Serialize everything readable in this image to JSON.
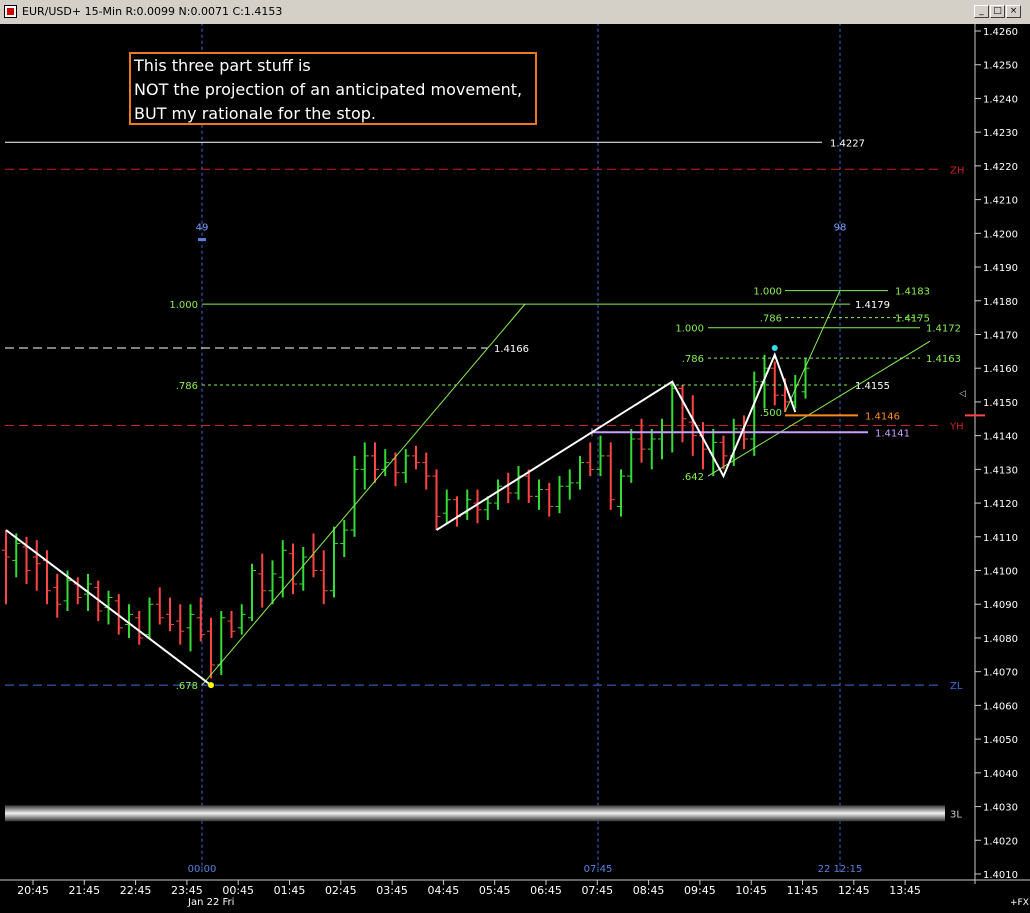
{
  "window": {
    "title": "EUR/USD+ 15-Min R:0.0099 N:0.0071 C:1.4153",
    "buttons": [
      "_",
      "□",
      "×"
    ]
  },
  "annotation": [
    "This three part stuff is",
    "NOT the projection of an anticipated movement,",
    "BUT my rationale for the stop."
  ],
  "colors": {
    "background": "#000000",
    "up_bar": "#33dd33",
    "down_bar": "#ff4444",
    "fib_line": "#88ee55",
    "zone_red": "#d02020",
    "zone_blue": "#3a6edc",
    "pattern": "#ffffff",
    "stop_line": "#ff8c1a",
    "yh_line": "#c8a0ff",
    "note_border": "#e87a20"
  },
  "chart_data": {
    "type": "candlestick",
    "symbol": "EUR/USD+",
    "interval": "15-Min",
    "ylim": [
      1.401,
      1.4266
    ],
    "y_ticks": [
      "1.4260",
      "1.4250",
      "1.4240",
      "1.4230",
      "1.4220",
      "1.4210",
      "1.4200",
      "1.4190",
      "1.4180",
      "1.4170",
      "1.4160",
      "1.4150",
      "1.4140",
      "1.4130",
      "1.4120",
      "1.4110",
      "1.4100",
      "1.4090",
      "1.4080",
      "1.4070",
      "1.4060",
      "1.4050",
      "1.4040",
      "1.4030",
      "1.4020",
      "1.4010"
    ],
    "x_ticks": [
      "20:45",
      "21:45",
      "22:45",
      "23:45",
      "00:45",
      "01:45",
      "02:45",
      "03:45",
      "04:45",
      "05:45",
      "06:45",
      "07:45",
      "08:45",
      "09:45",
      "10:45",
      "11:45",
      "12:45",
      "13:45"
    ],
    "x_sublabel": "Jan 22 Fri",
    "axis_corner": "+FX",
    "bars": [
      {
        "o": 1.4106,
        "h": 1.4112,
        "l": 1.409,
        "c": 1.4104
      },
      {
        "o": 1.4103,
        "h": 1.4111,
        "l": 1.4098,
        "c": 1.4108
      },
      {
        "o": 1.4107,
        "h": 1.411,
        "l": 1.4096,
        "c": 1.41
      },
      {
        "o": 1.4104,
        "h": 1.4109,
        "l": 1.4094,
        "c": 1.4102
      },
      {
        "o": 1.4103,
        "h": 1.4106,
        "l": 1.409,
        "c": 1.4094
      },
      {
        "o": 1.4095,
        "h": 1.4099,
        "l": 1.4086,
        "c": 1.409
      },
      {
        "o": 1.4091,
        "h": 1.41,
        "l": 1.4088,
        "c": 1.4097
      },
      {
        "o": 1.4096,
        "h": 1.4098,
        "l": 1.409,
        "c": 1.4092
      },
      {
        "o": 1.4093,
        "h": 1.4099,
        "l": 1.4088,
        "c": 1.4096
      },
      {
        "o": 1.4095,
        "h": 1.4097,
        "l": 1.4085,
        "c": 1.4088
      },
      {
        "o": 1.4089,
        "h": 1.4094,
        "l": 1.4084,
        "c": 1.4092
      },
      {
        "o": 1.4091,
        "h": 1.4093,
        "l": 1.4081,
        "c": 1.4083
      },
      {
        "o": 1.4084,
        "h": 1.409,
        "l": 1.408,
        "c": 1.4087
      },
      {
        "o": 1.4086,
        "h": 1.4088,
        "l": 1.4078,
        "c": 1.408
      },
      {
        "o": 1.4081,
        "h": 1.4092,
        "l": 1.408,
        "c": 1.409
      },
      {
        "o": 1.409,
        "h": 1.4095,
        "l": 1.4084,
        "c": 1.4086
      },
      {
        "o": 1.4087,
        "h": 1.4092,
        "l": 1.4082,
        "c": 1.4084
      },
      {
        "o": 1.4085,
        "h": 1.409,
        "l": 1.4078,
        "c": 1.4082
      },
      {
        "o": 1.4083,
        "h": 1.409,
        "l": 1.4076,
        "c": 1.4087
      },
      {
        "o": 1.4086,
        "h": 1.4092,
        "l": 1.4079,
        "c": 1.4081
      },
      {
        "o": 1.4082,
        "h": 1.4086,
        "l": 1.4068,
        "c": 1.4072
      },
      {
        "o": 1.4072,
        "h": 1.4088,
        "l": 1.4069,
        "c": 1.4086
      },
      {
        "o": 1.4085,
        "h": 1.4088,
        "l": 1.408,
        "c": 1.4082
      },
      {
        "o": 1.4083,
        "h": 1.409,
        "l": 1.4081,
        "c": 1.4087
      },
      {
        "o": 1.4086,
        "h": 1.4102,
        "l": 1.4085,
        "c": 1.41
      },
      {
        "o": 1.4099,
        "h": 1.4105,
        "l": 1.4089,
        "c": 1.4094
      },
      {
        "o": 1.4094,
        "h": 1.4103,
        "l": 1.409,
        "c": 1.4099
      },
      {
        "o": 1.4098,
        "h": 1.4109,
        "l": 1.4092,
        "c": 1.4106
      },
      {
        "o": 1.4105,
        "h": 1.4108,
        "l": 1.4093,
        "c": 1.4096
      },
      {
        "o": 1.4096,
        "h": 1.4107,
        "l": 1.4094,
        "c": 1.4104
      },
      {
        "o": 1.4104,
        "h": 1.4111,
        "l": 1.4098,
        "c": 1.41
      },
      {
        "o": 1.41,
        "h": 1.4106,
        "l": 1.409,
        "c": 1.4094
      },
      {
        "o": 1.4094,
        "h": 1.4113,
        "l": 1.4092,
        "c": 1.4108
      },
      {
        "o": 1.4108,
        "h": 1.4115,
        "l": 1.4104,
        "c": 1.4112
      },
      {
        "o": 1.4112,
        "h": 1.4134,
        "l": 1.411,
        "c": 1.413
      },
      {
        "o": 1.413,
        "h": 1.4138,
        "l": 1.4124,
        "c": 1.4134
      },
      {
        "o": 1.4134,
        "h": 1.4138,
        "l": 1.4126,
        "c": 1.413
      },
      {
        "o": 1.413,
        "h": 1.4136,
        "l": 1.4128,
        "c": 1.4132
      },
      {
        "o": 1.4133,
        "h": 1.4135,
        "l": 1.4125,
        "c": 1.4129
      },
      {
        "o": 1.4129,
        "h": 1.4136,
        "l": 1.4126,
        "c": 1.4134
      },
      {
        "o": 1.4134,
        "h": 1.4137,
        "l": 1.413,
        "c": 1.4132
      },
      {
        "o": 1.4132,
        "h": 1.4135,
        "l": 1.4124,
        "c": 1.4128
      },
      {
        "o": 1.4128,
        "h": 1.413,
        "l": 1.4112,
        "c": 1.4116
      },
      {
        "o": 1.4117,
        "h": 1.4124,
        "l": 1.4114,
        "c": 1.4121
      },
      {
        "o": 1.4121,
        "h": 1.4122,
        "l": 1.4113,
        "c": 1.4116
      },
      {
        "o": 1.4117,
        "h": 1.4124,
        "l": 1.4115,
        "c": 1.4121
      },
      {
        "o": 1.412,
        "h": 1.4124,
        "l": 1.4114,
        "c": 1.4118
      },
      {
        "o": 1.4118,
        "h": 1.4122,
        "l": 1.4115,
        "c": 1.412
      },
      {
        "o": 1.412,
        "h": 1.4127,
        "l": 1.4118,
        "c": 1.4125
      },
      {
        "o": 1.4125,
        "h": 1.4129,
        "l": 1.412,
        "c": 1.4123
      },
      {
        "o": 1.4123,
        "h": 1.4131,
        "l": 1.4121,
        "c": 1.4128
      },
      {
        "o": 1.4128,
        "h": 1.413,
        "l": 1.412,
        "c": 1.4122
      },
      {
        "o": 1.4122,
        "h": 1.4127,
        "l": 1.4118,
        "c": 1.4124
      },
      {
        "o": 1.4124,
        "h": 1.4126,
        "l": 1.4116,
        "c": 1.4119
      },
      {
        "o": 1.4119,
        "h": 1.4128,
        "l": 1.4117,
        "c": 1.4125
      },
      {
        "o": 1.4125,
        "h": 1.413,
        "l": 1.4121,
        "c": 1.4126
      },
      {
        "o": 1.4126,
        "h": 1.4134,
        "l": 1.4124,
        "c": 1.4132
      },
      {
        "o": 1.4132,
        "h": 1.4138,
        "l": 1.4128,
        "c": 1.413
      },
      {
        "o": 1.413,
        "h": 1.414,
        "l": 1.4128,
        "c": 1.4134
      },
      {
        "o": 1.4134,
        "h": 1.4138,
        "l": 1.4118,
        "c": 1.4121
      },
      {
        "o": 1.4119,
        "h": 1.413,
        "l": 1.4116,
        "c": 1.4128
      },
      {
        "o": 1.4128,
        "h": 1.4142,
        "l": 1.4126,
        "c": 1.4139
      },
      {
        "o": 1.4139,
        "h": 1.4145,
        "l": 1.4132,
        "c": 1.4136
      },
      {
        "o": 1.4136,
        "h": 1.4142,
        "l": 1.413,
        "c": 1.4139
      },
      {
        "o": 1.4139,
        "h": 1.4145,
        "l": 1.4133,
        "c": 1.4141
      },
      {
        "o": 1.4141,
        "h": 1.4156,
        "l": 1.4135,
        "c": 1.4154
      },
      {
        "o": 1.4154,
        "h": 1.4155,
        "l": 1.4138,
        "c": 1.4145
      },
      {
        "o": 1.4144,
        "h": 1.4152,
        "l": 1.4134,
        "c": 1.414
      },
      {
        "o": 1.414,
        "h": 1.4144,
        "l": 1.413,
        "c": 1.4136
      },
      {
        "o": 1.4135,
        "h": 1.4142,
        "l": 1.4128,
        "c": 1.4138
      },
      {
        "o": 1.4138,
        "h": 1.414,
        "l": 1.413,
        "c": 1.4134
      },
      {
        "o": 1.4134,
        "h": 1.4145,
        "l": 1.4131,
        "c": 1.4142
      },
      {
        "o": 1.4142,
        "h": 1.4146,
        "l": 1.4136,
        "c": 1.4139
      },
      {
        "o": 1.4139,
        "h": 1.4159,
        "l": 1.4134,
        "c": 1.4156
      },
      {
        "o": 1.4156,
        "h": 1.4164,
        "l": 1.4148,
        "c": 1.416
      },
      {
        "o": 1.416,
        "h": 1.4162,
        "l": 1.4149,
        "c": 1.4152
      },
      {
        "o": 1.4152,
        "h": 1.4157,
        "l": 1.4147,
        "c": 1.415
      },
      {
        "o": 1.415,
        "h": 1.4158,
        "l": 1.4148,
        "c": 1.4155
      },
      {
        "o": 1.4153,
        "h": 1.4163,
        "l": 1.4151,
        "c": 1.416
      }
    ],
    "horizontal_lines": [
      {
        "label": "1.4227",
        "value": 1.4227,
        "color": "#ffffff",
        "style": "solid"
      },
      {
        "label": "ZH",
        "value": 1.4219,
        "color": "#d02020",
        "style": "dashed"
      },
      {
        "label": "1.4166",
        "value": 1.4166,
        "color": "#ffffff",
        "style": "dashed"
      },
      {
        "label": "YH",
        "value": 1.4143,
        "color": "#d02020",
        "style": "dashed"
      },
      {
        "label": "ZL",
        "value": 1.4066,
        "color": "#3a6edc",
        "style": "dashed"
      },
      {
        "label": "3L",
        "value": 1.4028,
        "color": "#cccccc",
        "style": "band"
      }
    ],
    "vertical_markers": [
      {
        "label": "49",
        "bottom_label": "00:00"
      },
      {
        "label": "",
        "bottom_label": "07:45"
      },
      {
        "label": "98",
        "bottom_label": "22 12:15"
      }
    ],
    "fib_left": {
      "levels": [
        {
          "ratio": "1.000",
          "value": 1.4179,
          "label": "1.4179"
        },
        {
          "ratio": ".786",
          "value": 1.4155,
          "label": "1.4155"
        }
      ],
      "swing_low_ratio": ".678",
      "swing_low": 1.4066,
      "swing_high": 1.4179
    },
    "fib_right": {
      "levels": [
        {
          "ratio": "1.000",
          "value": 1.4183,
          "label": "1.4183"
        },
        {
          "ratio": ".786",
          "value": 1.4175,
          "label": "1.4175"
        },
        {
          "ratio": "1.000",
          "value": 1.4172,
          "label": "1.4172"
        },
        {
          "ratio": ".786",
          "value": 1.4163,
          "label": "1.4163"
        }
      ],
      "ratio_labels": [
        ".642",
        ".500"
      ]
    },
    "stop_line": {
      "label": "1.4146",
      "value": 1.4146
    },
    "yh_line": {
      "label": "1.4141",
      "value": 1.4141
    },
    "pattern_points": [
      {
        "bar": 0,
        "value": 1.4112
      },
      {
        "bar": 20,
        "value": 1.4066
      },
      {
        "bar": 42,
        "value": 1.4112
      },
      {
        "bar": 65,
        "value": 1.4156
      },
      {
        "bar": 70,
        "value": 1.4128
      },
      {
        "bar": 75,
        "value": 1.4164
      },
      {
        "bar": 77,
        "value": 1.4147
      }
    ]
  }
}
